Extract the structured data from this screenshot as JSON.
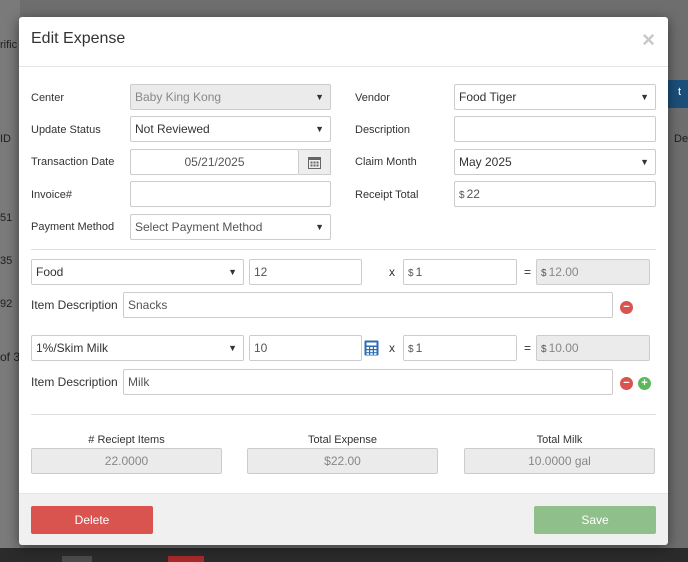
{
  "background": {
    "fragment_1": "rific",
    "fragment_2": "ID",
    "fragment_3": "51",
    "fragment_4": "35",
    "fragment_5": "92",
    "fragment_6": "of 3",
    "fragment_7": "De",
    "fragment_8": "t"
  },
  "modal": {
    "title": "Edit Expense",
    "close_glyph": "×"
  },
  "form": {
    "center": {
      "label": "Center",
      "value": "Baby King Kong"
    },
    "update_status": {
      "label": "Update Status",
      "value": "Not Reviewed"
    },
    "transaction_date": {
      "label": "Transaction Date",
      "value": "05/21/2025"
    },
    "invoice": {
      "label": "Invoice#",
      "value": ""
    },
    "payment_method": {
      "label": "Payment Method",
      "value": "Select Payment Method"
    },
    "vendor": {
      "label": "Vendor",
      "value": "Food Tiger"
    },
    "description": {
      "label": "Description",
      "value": ""
    },
    "claim_month": {
      "label": "Claim Month",
      "value": "May 2025"
    },
    "receipt_total": {
      "label": "Receipt Total",
      "currency": "$",
      "value": "22"
    }
  },
  "items": [
    {
      "category": "Food",
      "quantity": "12",
      "multiply": "x",
      "currency": "$",
      "unit_price": "1",
      "equals": "=",
      "total": "12.00",
      "desc_label": "Item Description",
      "description": "Snacks"
    },
    {
      "category": "1%/Skim Milk",
      "quantity": "10",
      "multiply": "x",
      "currency": "$",
      "unit_price": "1",
      "equals": "=",
      "total": "10.00",
      "desc_label": "Item Description",
      "description": "Milk"
    }
  ],
  "totals": {
    "receipt_items": {
      "label": "# Reciept Items",
      "value": "22.0000"
    },
    "total_expense": {
      "label": "Total Expense",
      "value": "$22.00"
    },
    "total_milk": {
      "label": "Total Milk",
      "value": "10.0000 gal"
    }
  },
  "footer": {
    "delete_label": "Delete",
    "save_label": "Save"
  },
  "colors": {
    "delete": "#d9534f",
    "save": "#8fbf8a",
    "minus_icon": "#d9534f",
    "plus_icon": "#5cb85c",
    "calculator_icon": "#2a6db5"
  },
  "glyphs": {
    "caret": "▼",
    "minus": "−",
    "plus": "+"
  }
}
